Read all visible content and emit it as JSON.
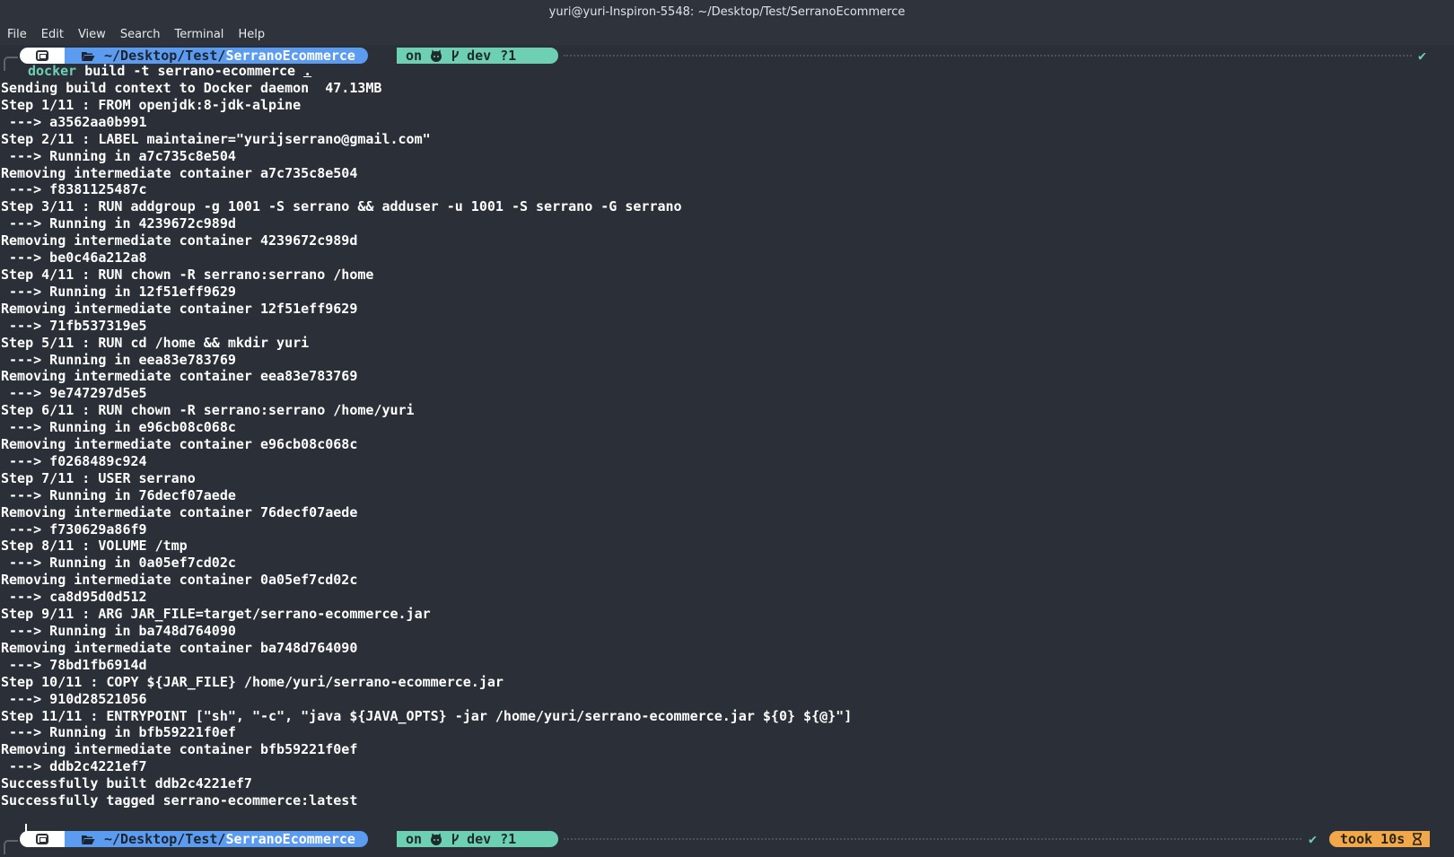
{
  "window": {
    "title": "yuri@yuri-Inspiron-5548: ~/Desktop/Test/SerranoEcommerce"
  },
  "menu": [
    "File",
    "Edit",
    "View",
    "Search",
    "Terminal",
    "Help"
  ],
  "prompt": {
    "os_icon": "terminal-os-icon",
    "folder_icon": "open-folder-icon",
    "dir_prefix": "~/Desktop/Test/",
    "dir_name": "SerranoEcommerce",
    "git_on": "on",
    "github_icon": "github-icon",
    "branch_icon": "git-branch-icon",
    "branch": "dev",
    "git_status": "?1",
    "status_ok": "✔",
    "hourglass_icon": "hourglass-icon"
  },
  "command": {
    "program": "docker",
    "args": " build -t serrano-ecommerce ",
    "context": "."
  },
  "output_lines": [
    "Sending build context to Docker daemon  47.13MB",
    "Step 1/11 : FROM openjdk:8-jdk-alpine",
    " ---> a3562aa0b991",
    "Step 2/11 : LABEL maintainer=\"yurijserrano@gmail.com\"",
    " ---> Running in a7c735c8e504",
    "Removing intermediate container a7c735c8e504",
    " ---> f8381125487c",
    "Step 3/11 : RUN addgroup -g 1001 -S serrano && adduser -u 1001 -S serrano -G serrano",
    " ---> Running in 4239672c989d",
    "Removing intermediate container 4239672c989d",
    " ---> be0c46a212a8",
    "Step 4/11 : RUN chown -R serrano:serrano /home",
    " ---> Running in 12f51eff9629",
    "Removing intermediate container 12f51eff9629",
    " ---> 71fb537319e5",
    "Step 5/11 : RUN cd /home && mkdir yuri",
    " ---> Running in eea83e783769",
    "Removing intermediate container eea83e783769",
    " ---> 9e747297d5e5",
    "Step 6/11 : RUN chown -R serrano:serrano /home/yuri",
    " ---> Running in e96cb08c068c",
    "Removing intermediate container e96cb08c068c",
    " ---> f0268489c924",
    "Step 7/11 : USER serrano",
    " ---> Running in 76decf07aede",
    "Removing intermediate container 76decf07aede",
    " ---> f730629a86f9",
    "Step 8/11 : VOLUME /tmp",
    " ---> Running in 0a05ef7cd02c",
    "Removing intermediate container 0a05ef7cd02c",
    " ---> ca8d95d0d512",
    "Step 9/11 : ARG JAR_FILE=target/serrano-ecommerce.jar",
    " ---> Running in ba748d764090",
    "Removing intermediate container ba748d764090",
    " ---> 78bd1fb6914d",
    "Step 10/11 : COPY ${JAR_FILE} /home/yuri/serrano-ecommerce.jar",
    " ---> 910d28521056",
    "Step 11/11 : ENTRYPOINT [\"sh\", \"-c\", \"java ${JAVA_OPTS} -jar /home/yuri/serrano-ecommerce.jar ${0} ${@}\"]",
    " ---> Running in bfb59221f0ef",
    "Removing intermediate container bfb59221f0ef",
    " ---> ddb2c4221ef7",
    "Successfully built ddb2c4221ef7",
    "Successfully tagged serrano-ecommerce:latest"
  ],
  "bottom_status": {
    "ok": "✔",
    "took": "took 10s"
  },
  "colors": {
    "background": "#2b3038",
    "dir_segment": "#5b9cf0",
    "git_segment": "#6ed0b3",
    "took_segment": "#f0a84a"
  }
}
